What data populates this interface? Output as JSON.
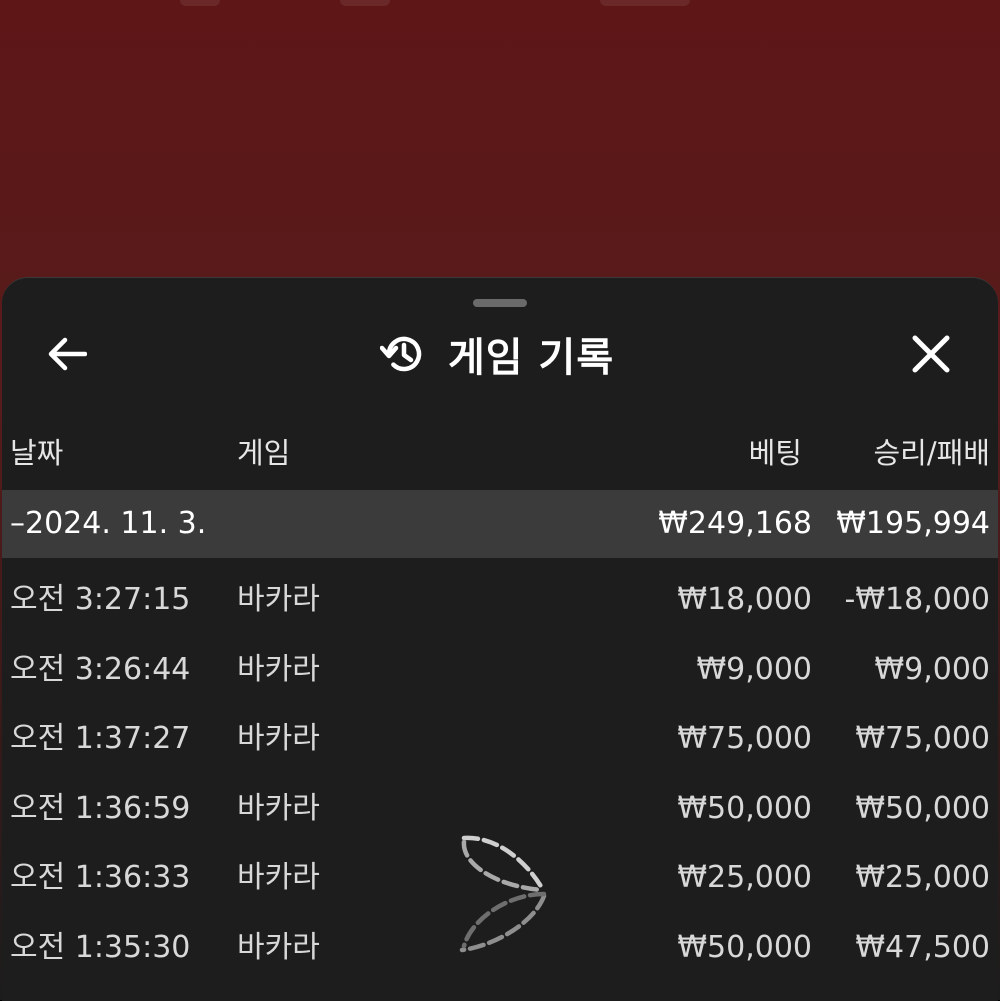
{
  "header": {
    "title": "게임 기록",
    "history_icon": "history-icon",
    "back_icon": "arrow-left-icon",
    "close_icon": "close-icon"
  },
  "columns": {
    "date": "날짜",
    "game": "게임",
    "bet": "베팅",
    "result": "승리/패배"
  },
  "group": {
    "date": "–2024. 11. 3.",
    "bet_total": "₩249,168",
    "result_total": "₩195,994"
  },
  "rows": [
    {
      "time": "오전 3:27:15",
      "game": "바카라",
      "bet": "₩18,000",
      "result": "-₩18,000"
    },
    {
      "time": "오전 3:26:44",
      "game": "바카라",
      "bet": "₩9,000",
      "result": "₩9,000"
    },
    {
      "time": "오전 1:37:27",
      "game": "바카라",
      "bet": "₩75,000",
      "result": "₩75,000"
    },
    {
      "time": "오전 1:36:59",
      "game": "바카라",
      "bet": "₩50,000",
      "result": "₩50,000"
    },
    {
      "time": "오전 1:36:33",
      "game": "바카라",
      "bet": "₩25,000",
      "result": "₩25,000"
    },
    {
      "time": "오전 1:35:30",
      "game": "바카라",
      "bet": "₩50,000",
      "result": "₩47,500"
    }
  ],
  "colors": {
    "background_top": "#5e1617",
    "sheet": "#1d1d1d",
    "group_row": "#3b3b3b",
    "text": "#ffffff"
  }
}
